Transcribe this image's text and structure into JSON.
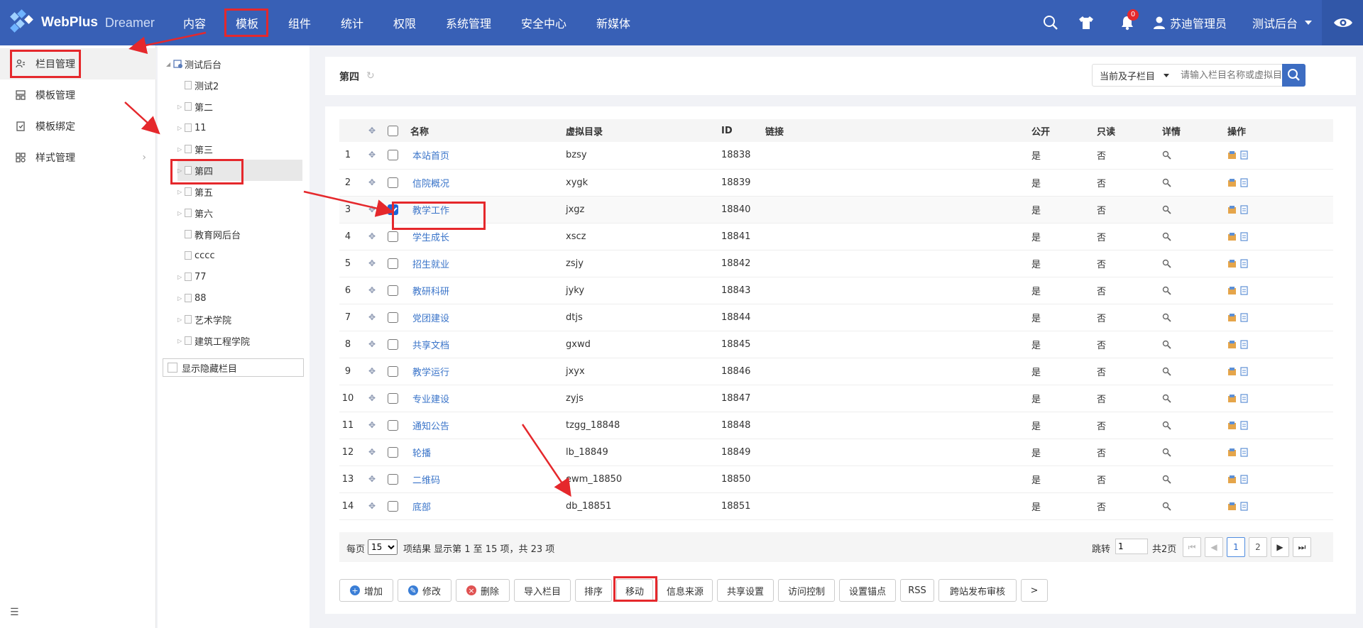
{
  "brand": {
    "name": "WebPlus",
    "product": "Dreamer"
  },
  "topnav": [
    "内容",
    "模板",
    "组件",
    "统计",
    "权限",
    "系统管理",
    "安全中心",
    "新媒体"
  ],
  "topright": {
    "notification_count": "0",
    "user": "苏迪管理员",
    "site": "测试后台"
  },
  "sidebar": {
    "items": [
      {
        "label": "栏目管理",
        "icon": "column-icon"
      },
      {
        "label": "模板管理",
        "icon": "template-icon"
      },
      {
        "label": "模板绑定",
        "icon": "bind-icon"
      },
      {
        "label": "样式管理",
        "icon": "style-icon"
      }
    ]
  },
  "tree": {
    "root": "测试后台",
    "nodes": [
      "测试2",
      "第二",
      "11",
      "第三",
      "第四",
      "第五",
      "第六",
      "教育网后台",
      "cccc",
      "77",
      "88",
      "艺术学院",
      "建筑工程学院"
    ],
    "show_hidden": "显示隐藏栏目"
  },
  "header": {
    "title": "第四",
    "scope": "当前及子栏目",
    "search_placeholder": "请输入栏目名称或虚拟目录"
  },
  "table": {
    "columns": [
      "名称",
      "虚拟目录",
      "ID",
      "链接",
      "公开",
      "只读",
      "详情",
      "操作"
    ],
    "rows": [
      {
        "no": "1",
        "name": "本站首页",
        "dir": "bzsy",
        "id": "18838",
        "link": "",
        "public": "是",
        "readonly": "否",
        "checked": false
      },
      {
        "no": "2",
        "name": "信院概况",
        "dir": "xygk",
        "id": "18839",
        "link": "",
        "public": "是",
        "readonly": "否",
        "checked": false
      },
      {
        "no": "3",
        "name": "教学工作",
        "dir": "jxgz",
        "id": "18840",
        "link": "",
        "public": "是",
        "readonly": "否",
        "checked": true
      },
      {
        "no": "4",
        "name": "学生成长",
        "dir": "xscz",
        "id": "18841",
        "link": "",
        "public": "是",
        "readonly": "否",
        "checked": false
      },
      {
        "no": "5",
        "name": "招生就业",
        "dir": "zsjy",
        "id": "18842",
        "link": "",
        "public": "是",
        "readonly": "否",
        "checked": false
      },
      {
        "no": "6",
        "name": "教研科研",
        "dir": "jyky",
        "id": "18843",
        "link": "",
        "public": "是",
        "readonly": "否",
        "checked": false
      },
      {
        "no": "7",
        "name": "党团建设",
        "dir": "dtjs",
        "id": "18844",
        "link": "",
        "public": "是",
        "readonly": "否",
        "checked": false
      },
      {
        "no": "8",
        "name": "共享文档",
        "dir": "gxwd",
        "id": "18845",
        "link": "",
        "public": "是",
        "readonly": "否",
        "checked": false
      },
      {
        "no": "9",
        "name": "教学运行",
        "dir": "jxyx",
        "id": "18846",
        "link": "",
        "public": "是",
        "readonly": "否",
        "checked": false
      },
      {
        "no": "10",
        "name": "专业建设",
        "dir": "zyjs",
        "id": "18847",
        "link": "",
        "public": "是",
        "readonly": "否",
        "checked": false
      },
      {
        "no": "11",
        "name": "通知公告",
        "dir": "tzgg_18848",
        "id": "18848",
        "link": "",
        "public": "是",
        "readonly": "否",
        "checked": false
      },
      {
        "no": "12",
        "name": "轮播",
        "dir": "lb_18849",
        "id": "18849",
        "link": "",
        "public": "是",
        "readonly": "否",
        "checked": false
      },
      {
        "no": "13",
        "name": "二维码",
        "dir": "ewm_18850",
        "id": "18850",
        "link": "",
        "public": "是",
        "readonly": "否",
        "checked": false
      },
      {
        "no": "14",
        "name": "底部",
        "dir": "db_18851",
        "id": "18851",
        "link": "",
        "public": "是",
        "readonly": "否",
        "checked": false
      }
    ]
  },
  "pager": {
    "per_page_label": "每页",
    "per_page": "15",
    "result_text": "项结果 显示第 1 至 15 项，共 23 项",
    "jump_label": "跳转",
    "jump_value": "1",
    "total_pages": "共2页",
    "pages": [
      "1",
      "2"
    ],
    "current_page": "1"
  },
  "actions": [
    "增加",
    "修改",
    "删除",
    "导入栏目",
    "排序",
    "移动",
    "信息来源",
    "共享设置",
    "访问控制",
    "设置锚点",
    "RSS",
    "跨站发布审核",
    ">"
  ],
  "colors": {
    "primary": "#3860b6",
    "link": "#3a74c9",
    "highlight": "#e5282c"
  }
}
